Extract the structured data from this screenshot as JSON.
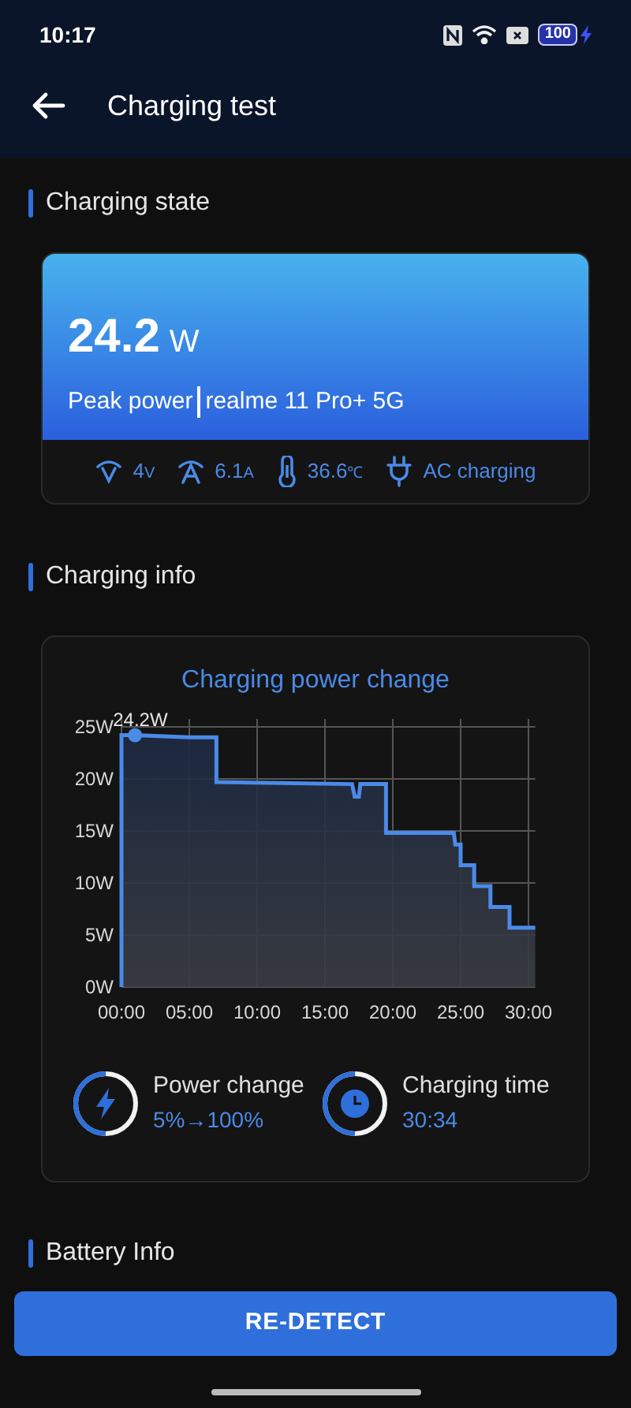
{
  "status_bar": {
    "time": "10:17",
    "battery": "100"
  },
  "header": {
    "title": "Charging test"
  },
  "sections": [
    {
      "title": "Charging state"
    },
    {
      "title": "Charging info"
    },
    {
      "title": "Battery Info"
    }
  ],
  "power_card": {
    "value": "24.2",
    "unit": "W",
    "label": "Peak power",
    "device": "realme 11 Pro+ 5G"
  },
  "stats": [
    {
      "kind": "voltage",
      "value": "4",
      "unit": "V"
    },
    {
      "kind": "current",
      "value": "6.1",
      "unit": "A"
    },
    {
      "kind": "temperature",
      "value": "36.6",
      "unit": "℃"
    },
    {
      "kind": "plug",
      "value": "AC charging"
    }
  ],
  "chart": {
    "chart_data": {
      "type": "line",
      "title": "Charging power change",
      "x": [
        0,
        0,
        1,
        5,
        7,
        7,
        17,
        17.2,
        17.5,
        17.6,
        19.5,
        19.5,
        24.5,
        24.6,
        25,
        25,
        26,
        26,
        27.2,
        27.2,
        28.6,
        28.6,
        30.5
      ],
      "grid": true,
      "series": [
        {
          "color": "#4a8ae8",
          "values": [
            0,
            24.2,
            24.2,
            24,
            24,
            19.7,
            19.5,
            18.3,
            18.3,
            19.5,
            19.5,
            14.8,
            14.8,
            13.7,
            13.7,
            11.7,
            11.7,
            9.7,
            9.7,
            7.7,
            7.7,
            5.7,
            5.7
          ]
        }
      ],
      "xlim": [
        0,
        30.5
      ],
      "ylim": [
        0,
        25
      ],
      "xticks": [
        {
          "value": 0,
          "label": "00:00"
        },
        {
          "value": 5,
          "label": "05:00"
        },
        {
          "value": 10,
          "label": "10:00"
        },
        {
          "value": 15,
          "label": "15:00"
        },
        {
          "value": 20,
          "label": "20:00"
        },
        {
          "value": 25,
          "label": "25:00"
        },
        {
          "value": 30,
          "label": "30:00"
        }
      ],
      "yticks": [
        {
          "value": 0,
          "label": "0W"
        },
        {
          "value": 5,
          "label": "5W"
        },
        {
          "value": 10,
          "label": "10W"
        },
        {
          "value": 15,
          "label": "15W"
        },
        {
          "value": 20,
          "label": "20W"
        },
        {
          "value": 25,
          "label": "25W"
        }
      ],
      "annotations": [
        {
          "x": 1,
          "y": 24.2,
          "text": "24.2W"
        }
      ]
    }
  },
  "summary": [
    {
      "kind": "power",
      "label": "Power change",
      "value": "5%→100%"
    },
    {
      "kind": "time",
      "label": "Charging time",
      "value": "30:34"
    }
  ],
  "button": {
    "label": "RE-DETECT"
  }
}
